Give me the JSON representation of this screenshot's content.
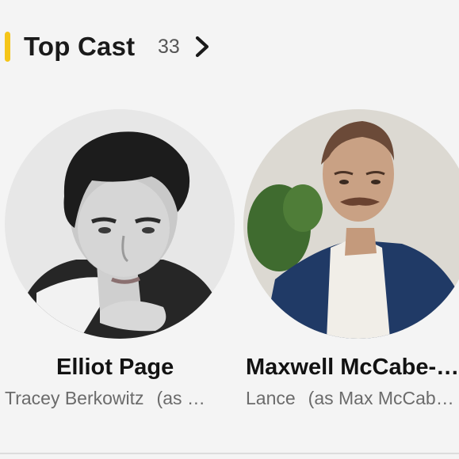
{
  "section": {
    "title": "Top Cast",
    "count": "33",
    "accent_color": "#f5c518",
    "see_all_icon": "chevron-right-icon"
  },
  "cast": [
    {
      "name": "Elliot Page",
      "character": "Tracey Berkowitz",
      "credit_note": "(as …",
      "photo_style": "black-and-white portrait"
    },
    {
      "name": "Maxwell McCabe-…",
      "character": "Lance",
      "credit_note": "(as Max McCab…",
      "photo_style": "color portrait"
    }
  ]
}
